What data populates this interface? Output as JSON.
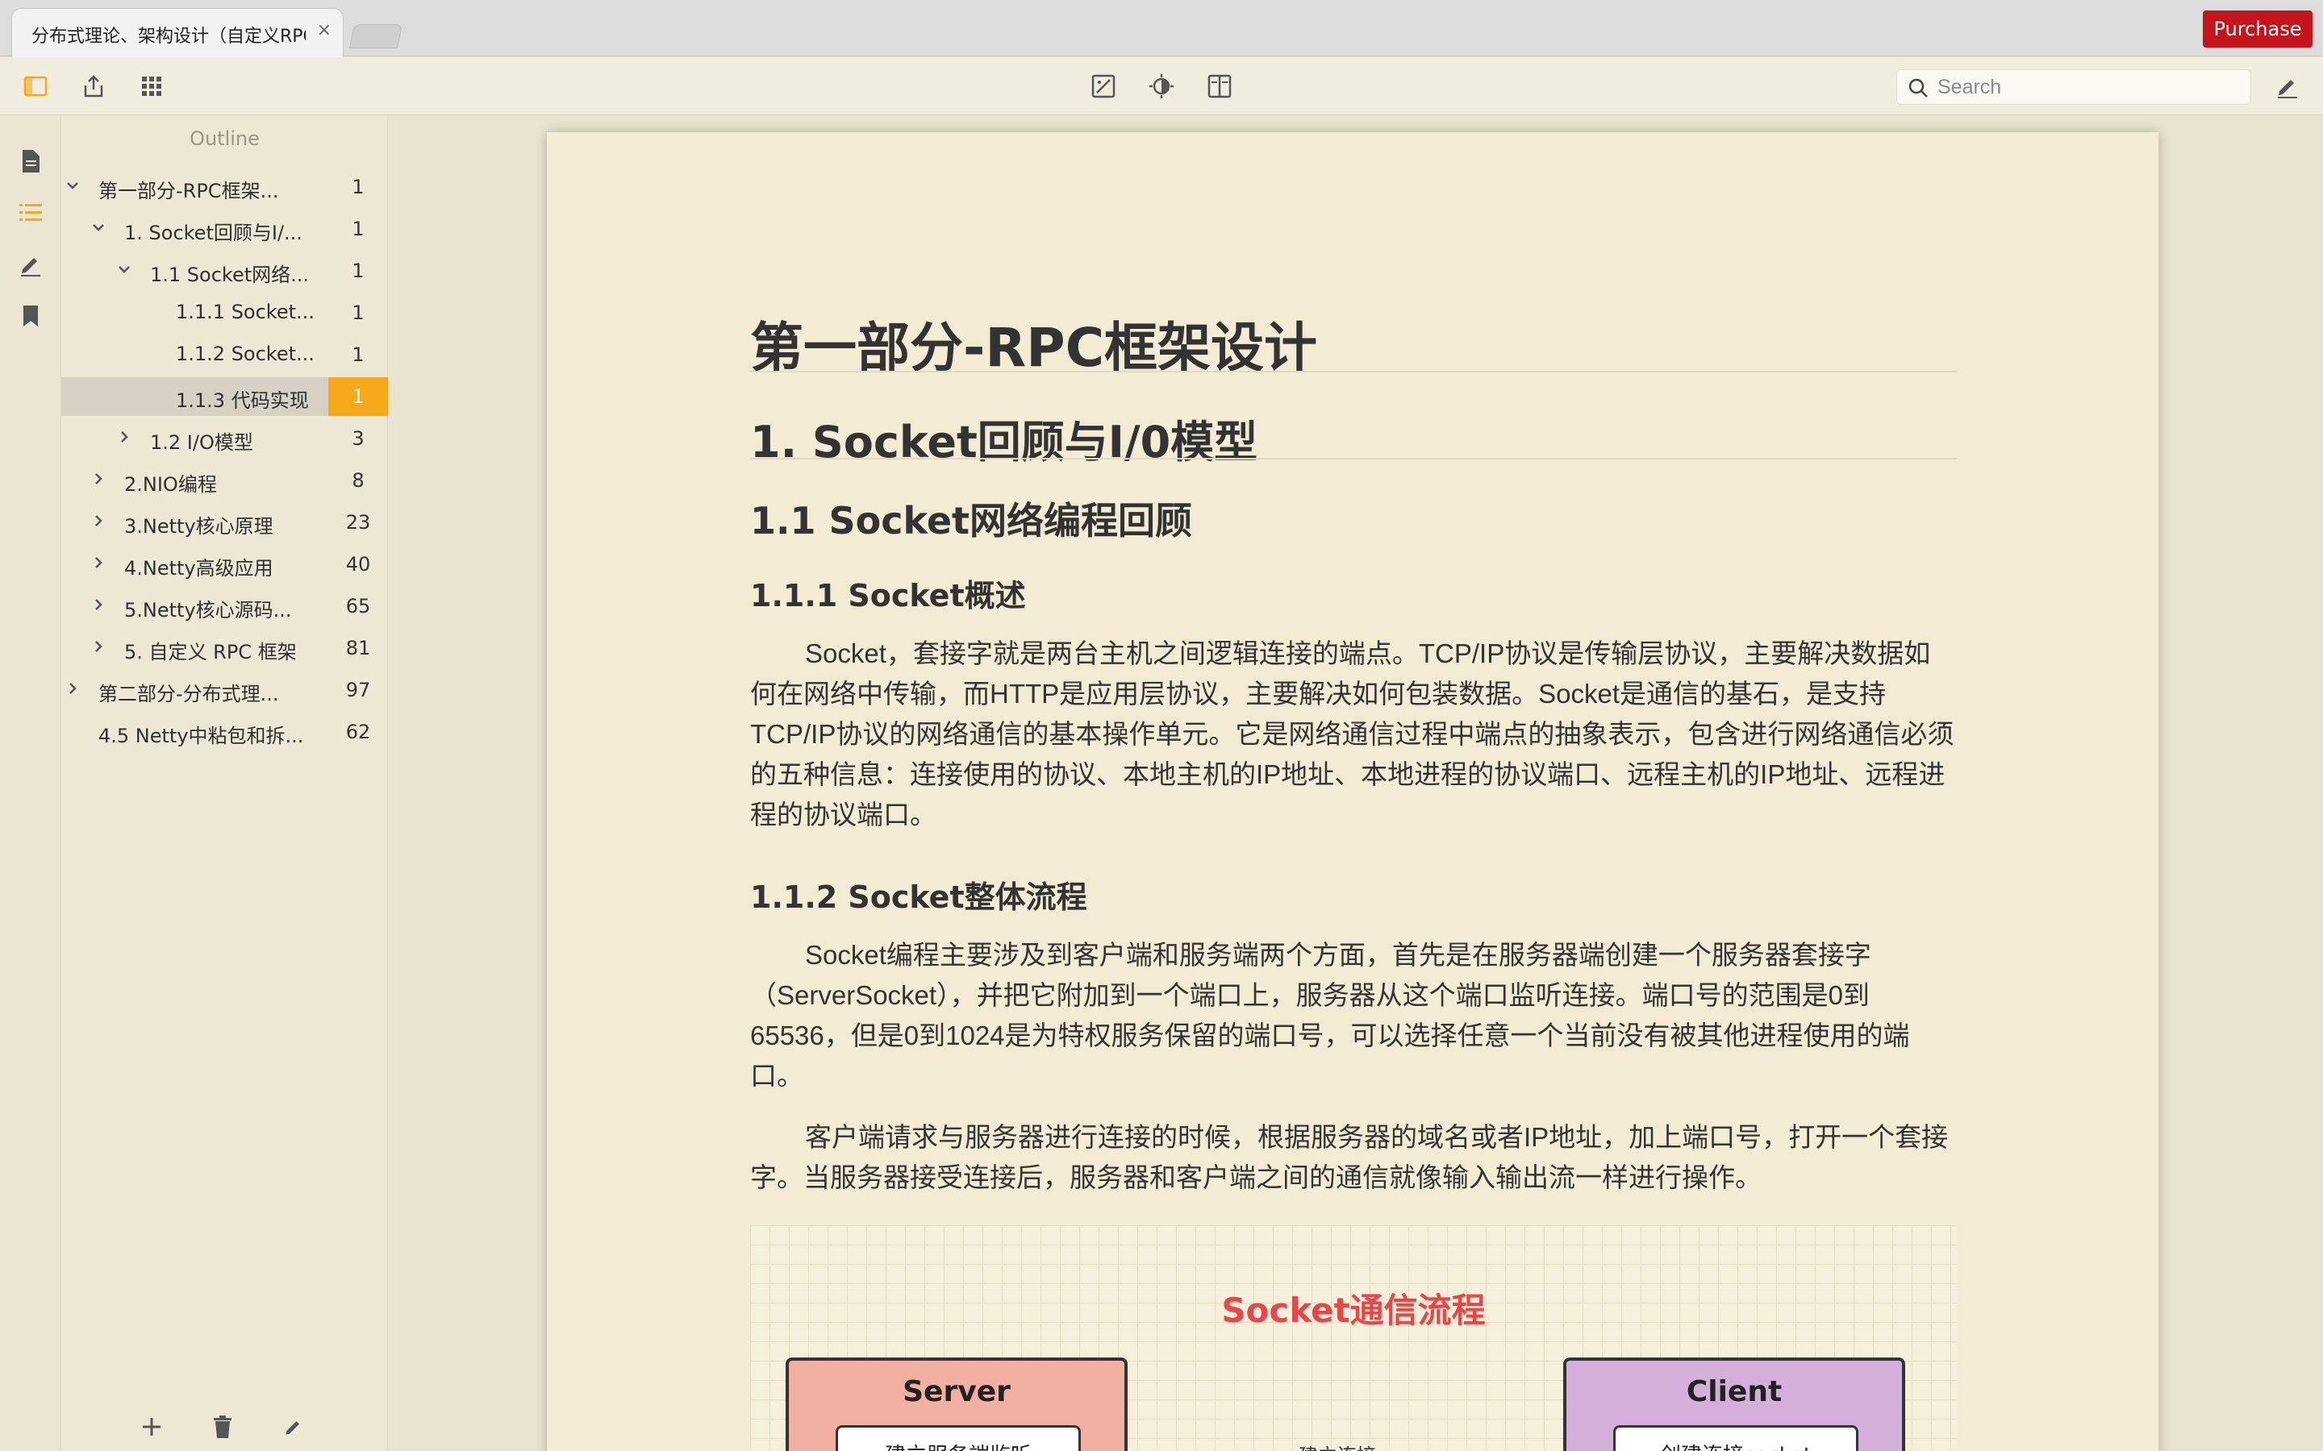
{
  "tab": {
    "title": "分布式理论、架构设计（自定义RPC）",
    "close": "×"
  },
  "purchase_label": "Purchase",
  "search": {
    "placeholder": "Search",
    "value": ""
  },
  "outline": {
    "title": "Outline",
    "items": [
      {
        "label": "第一部分-RPC框架...",
        "count": "1",
        "level": 0,
        "chevron": "down"
      },
      {
        "label": "1. Socket回顾与I/...",
        "count": "1",
        "level": 1,
        "chevron": "down"
      },
      {
        "label": "1.1 Socket网络...",
        "count": "1",
        "level": 2,
        "chevron": "down"
      },
      {
        "label": "1.1.1 Socket...",
        "count": "1",
        "level": 3,
        "chevron": "none"
      },
      {
        "label": "1.1.2 Socket...",
        "count": "1",
        "level": 3,
        "chevron": "none"
      },
      {
        "label": "1.1.3 代码实现",
        "count": "1",
        "level": 3,
        "chevron": "none",
        "selected": true
      },
      {
        "label": "1.2  I/O模型",
        "count": "3",
        "level": 2,
        "chevron": "right"
      },
      {
        "label": "2.NIO编程",
        "count": "8",
        "level": 1,
        "chevron": "right"
      },
      {
        "label": "3.Netty核心原理",
        "count": "23",
        "level": 1,
        "chevron": "right"
      },
      {
        "label": "4.Netty高级应用",
        "count": "40",
        "level": 1,
        "chevron": "right"
      },
      {
        "label": "5.Netty核心源码...",
        "count": "65",
        "level": 1,
        "chevron": "right"
      },
      {
        "label": "5. 自定义 RPC 框架",
        "count": "81",
        "level": 1,
        "chevron": "right"
      },
      {
        "label": "第二部分-分布式理...",
        "count": "97",
        "level": 0,
        "chevron": "right"
      },
      {
        "label": "4.5 Netty中粘包和拆...",
        "count": "62",
        "level": 0,
        "chevron": "none"
      }
    ]
  },
  "doc": {
    "h1": "第一部分-RPC框架设计",
    "h2": "1. Socket回顾与I/0模型",
    "h3": "1.1 Socket网络编程回顾",
    "h4a": "1.1.1 Socket概述",
    "p1": "Socket，套接字就是两台主机之间逻辑连接的端点。TCP/IP协议是传输层协议，主要解决数据如何在网络中传输，而HTTP是应用层协议，主要解决如何包装数据。Socket是通信的基石，是支持TCP/IP协议的网络通信的基本操作单元。它是网络通信过程中端点的抽象表示，包含进行网络通信必须的五种信息：连接使用的协议、本地主机的IP地址、本地进程的协议端口、远程主机的IP地址、远程进程的协议端口。",
    "h4b": "1.1.2 Socket整体流程",
    "p2": "Socket编程主要涉及到客户端和服务端两个方面，首先是在服务器端创建一个服务器套接字（ServerSocket），并把它附加到一个端口上，服务器从这个端口监听连接。端口号的范围是0到65536，但是0到1024是为特权服务保留的端口号，可以选择任意一个当前没有被其他进程使用的端口。",
    "p3": "客户端请求与服务器进行连接的时候，根据服务器的域名或者IP地址，加上端口号，打开一个套接字。当服务器接受连接后，服务器和客户端之间的通信就像输入输出流一样进行操作。"
  },
  "diagram": {
    "title": "Socket通信流程",
    "server_title": "Server",
    "server_step": "建立服务端监听",
    "client_title": "Client",
    "client_step": "创建连接socket",
    "connect_label": "建立连接",
    "server_color": "#f2b0a3",
    "client_color": "#d3afd9",
    "title_color": "#e8474a"
  },
  "colors": {
    "accent": "#f6a81b",
    "purchase": "#c4151c",
    "page": "#f3ebd4"
  }
}
